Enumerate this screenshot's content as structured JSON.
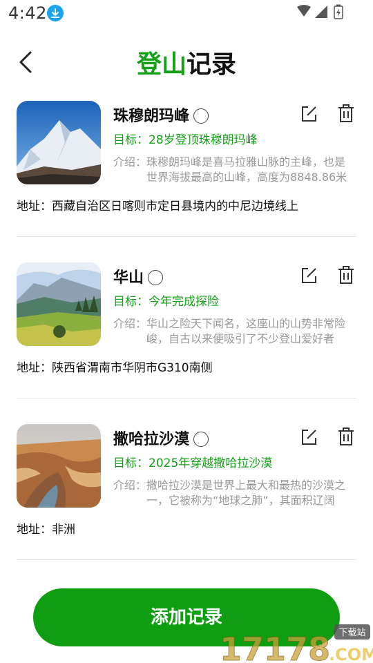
{
  "status_bar": {
    "time": "4:42",
    "icons": [
      "download-icon",
      "wifi-icon",
      "signal-icon",
      "battery-icon"
    ]
  },
  "header": {
    "title_accent": "登山",
    "title_rest": "记录",
    "back_icon": "chevron-left-icon",
    "accent_color": "#16a01a"
  },
  "records": [
    {
      "name": "珠穆朗玛峰",
      "goal": "目标：28岁登顶珠穆朗玛峰",
      "intro_label": "介绍：",
      "intro": "珠穆朗玛峰是喜马拉雅山脉的主峰，也是世界海拔最高的山峰，高度为8848.86米",
      "address": "地址：西藏自治区日喀则市定日县境内的中尼边境线上",
      "image": "snowy-mountain-photo"
    },
    {
      "name": "华山",
      "goal": "目标：今年完成探险",
      "intro_label": "介绍：",
      "intro": "华山之险天下闻名，这座山的山势非常险峻，自古以来便吸引了不少登山爱好者",
      "address": "地址：陕西省渭南市华阴市G310南侧",
      "image": "green-valley-photo"
    },
    {
      "name": "撒哈拉沙漠",
      "goal": "目标：2025年穿越撒哈拉沙漠",
      "intro_label": "介绍：",
      "intro": "撒哈拉沙漠是世界上最大和最热的沙漠之一，它被称为“地球之肺”，其面积辽阔",
      "address": "地址：非洲",
      "image": "desert-canyon-photo"
    }
  ],
  "add_button": {
    "label": "添加记录",
    "color": "#0f9d12"
  },
  "watermark": {
    "text": "17178",
    "suffix": ".COM",
    "badge": "下载站"
  }
}
